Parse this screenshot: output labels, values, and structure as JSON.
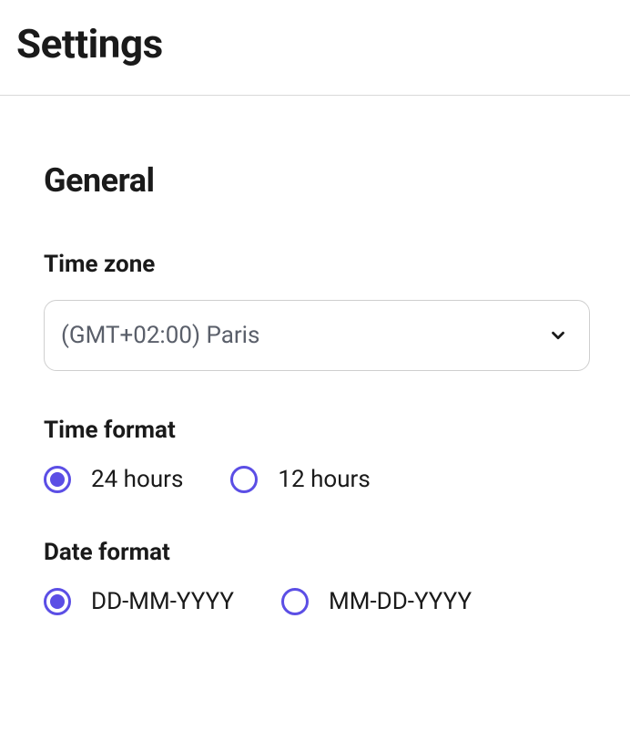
{
  "page": {
    "title": "Settings"
  },
  "general": {
    "title": "General",
    "timezone": {
      "label": "Time zone",
      "value": "(GMT+02:00) Paris"
    },
    "timeformat": {
      "label": "Time format",
      "options": [
        {
          "label": "24 hours",
          "selected": true
        },
        {
          "label": "12 hours",
          "selected": false
        }
      ]
    },
    "dateformat": {
      "label": "Date format",
      "options": [
        {
          "label": "DD-MM-YYYY",
          "selected": true
        },
        {
          "label": "MM-DD-YYYY",
          "selected": false
        }
      ]
    }
  }
}
